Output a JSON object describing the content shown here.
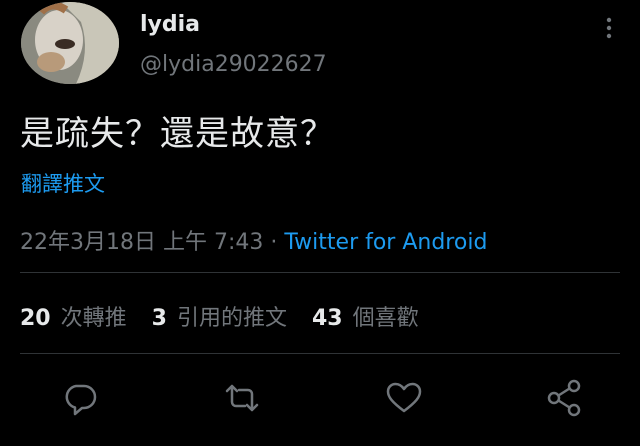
{
  "author": {
    "display_name": "lydia",
    "handle": "@lydia29022627",
    "avatar_icon": "avatar-photo"
  },
  "tweet": {
    "text": "是疏失？還是故意？",
    "translate_label": "翻譯推文",
    "timestamp": "22年3月18日 上午 7:43",
    "separator": " · ",
    "source": "Twitter for Android"
  },
  "stats": {
    "retweets": {
      "count": "20",
      "label": "次轉推"
    },
    "quotes": {
      "count": "3",
      "label": "引用的推文"
    },
    "likes": {
      "count": "43",
      "label": "個喜歡"
    }
  },
  "actions": {
    "reply_icon": "reply-icon",
    "retweet_icon": "retweet-icon",
    "like_icon": "heart-icon",
    "share_icon": "share-icon"
  },
  "colors": {
    "background": "#000000",
    "text_primary": "#e7e9ea",
    "text_secondary": "#71767b",
    "accent": "#1d9bf0",
    "divider": "#2f3336"
  }
}
